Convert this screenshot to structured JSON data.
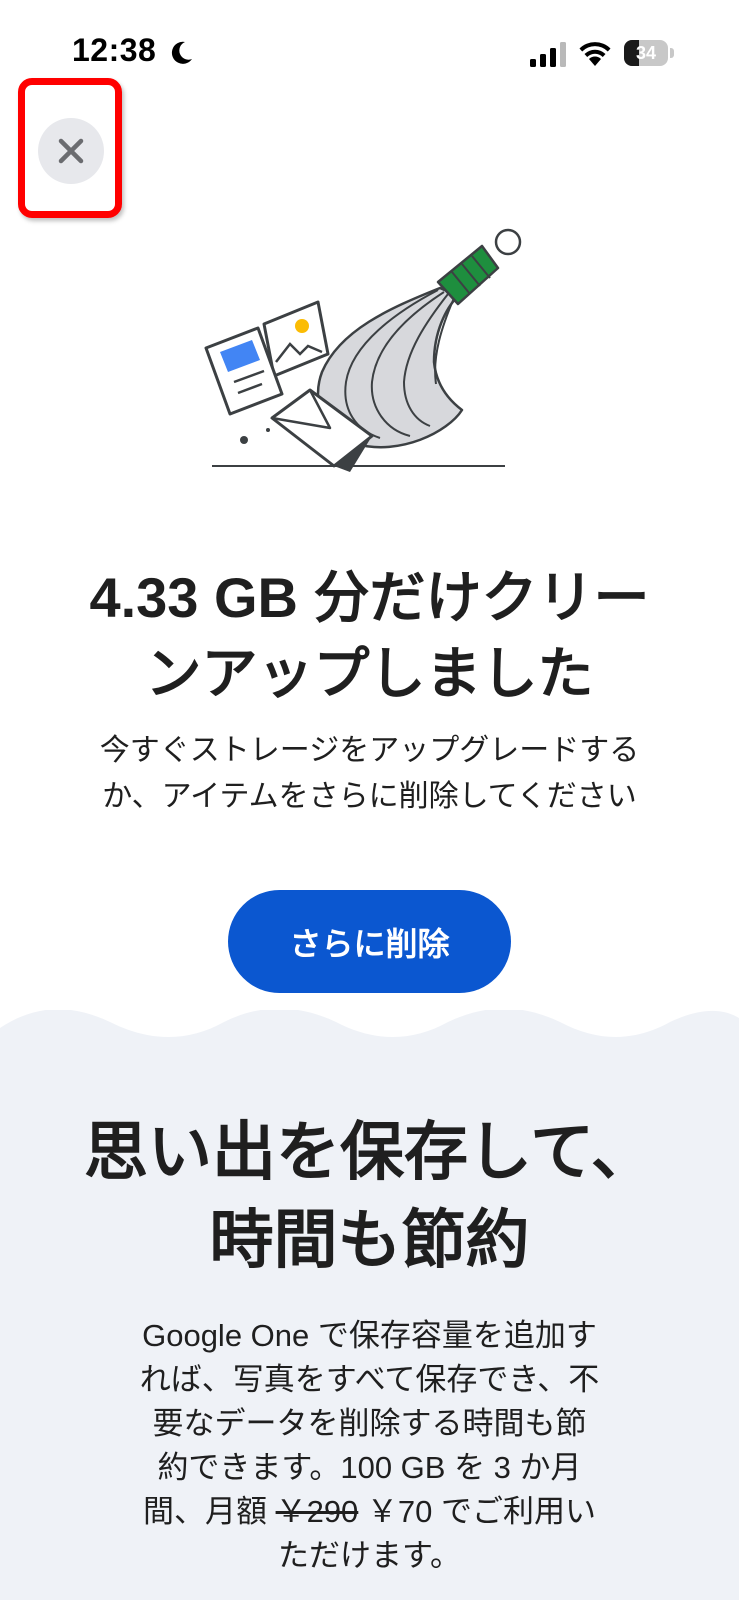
{
  "status_bar": {
    "time": "12:38",
    "battery_percent": 34,
    "battery_label": "34",
    "icons": [
      "moon-icon",
      "signal-icon",
      "wifi-icon",
      "battery-icon"
    ]
  },
  "close_button": {
    "icon": "close-icon",
    "highlight_color": "#ff0000"
  },
  "cleanup": {
    "title_line1": "4.33 GB 分だけクリー",
    "title_line2": "ンアップしました",
    "subtitle_line1": "今すぐストレージをアップグレードする",
    "subtitle_line2": "か、アイテムをさらに削除してください",
    "button_label": "さらに削除",
    "button_color": "#0b57d0"
  },
  "promo": {
    "title_line1": "思い出を保存して、",
    "title_line2": "時間も節約",
    "body_line1": "Google One で保存容量を追加す",
    "body_line2": "れば、写真をすべて保存でき、不",
    "body_line3": "要なデータを削除する時間も節",
    "body_line4": "約できます。100 GB を 3 か月",
    "body_line5_prefix": "間、月額 ",
    "old_price": "￥290",
    "new_price_text": " ￥70 でご利用い",
    "body_line6": "ただけます。",
    "background_color": "#eff2f7"
  },
  "illustration": {
    "icons": [
      "broom-icon",
      "document-icon",
      "photo-icon",
      "envelope-icon"
    ],
    "accent_colors": {
      "broom_handle": "#1e8e3e",
      "document_block": "#4285f4",
      "photo_sun": "#fbbc04",
      "bristles": "#d7d8dc"
    }
  }
}
